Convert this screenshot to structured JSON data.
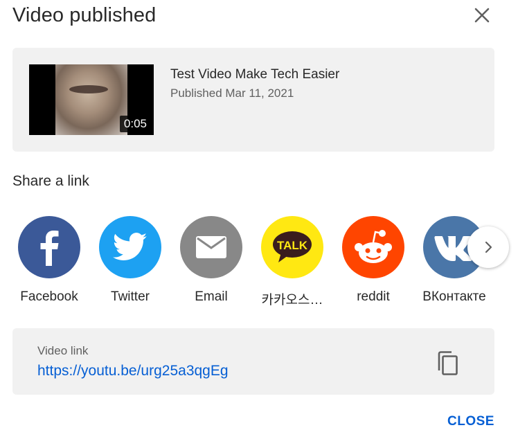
{
  "dialog": {
    "title": "Video published",
    "close_label": "CLOSE"
  },
  "video": {
    "title": "Test Video Make Tech Easier",
    "published": "Published Mar 11, 2021",
    "duration": "0:05"
  },
  "share": {
    "heading": "Share a link",
    "items": [
      {
        "label": "Facebook",
        "icon": "facebook-icon",
        "color": "#3b5998"
      },
      {
        "label": "Twitter",
        "icon": "twitter-icon",
        "color": "#1da1f2"
      },
      {
        "label": "Email",
        "icon": "email-icon",
        "color": "#888888"
      },
      {
        "label": "카카오스…",
        "icon": "kakao-talk-icon",
        "color": "#ffe812"
      },
      {
        "label": "reddit",
        "icon": "reddit-icon",
        "color": "#ff4500"
      },
      {
        "label": "ВКонтакте",
        "icon": "vk-icon",
        "color": "#4a76a8"
      }
    ],
    "kakao_badge": "TALK"
  },
  "link": {
    "label": "Video link",
    "url": "https://youtu.be/urg25a3qgEg"
  }
}
